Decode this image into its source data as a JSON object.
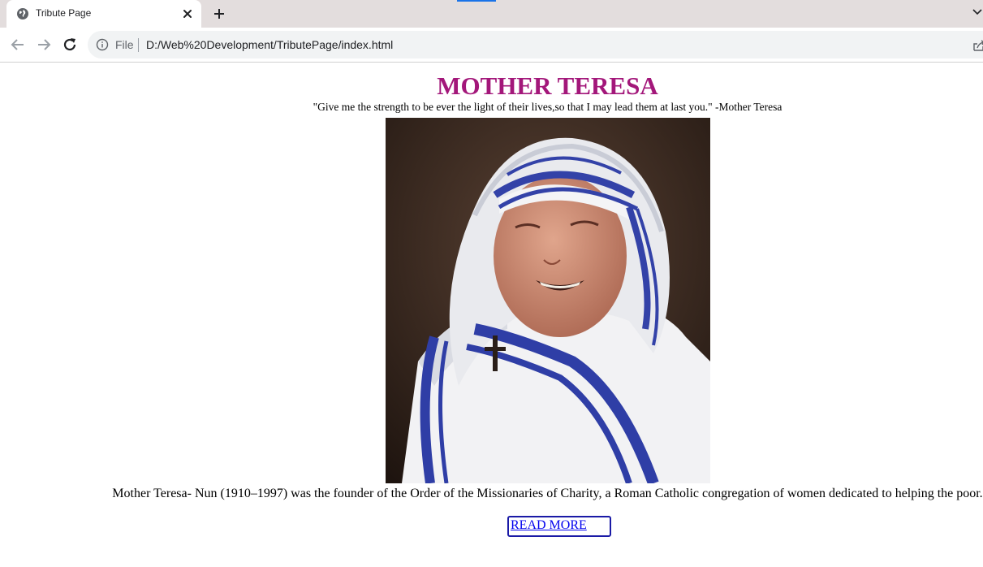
{
  "browser": {
    "tab_title": "Tribute Page",
    "url_scheme": "File",
    "url": "D:/Web%20Development/TributePage/index.html"
  },
  "page": {
    "title": "MOTHER TERESA",
    "quote": "\"Give me the strength to be ever the light of their lives,so that I may lead them at last you.\" -Mother Teresa",
    "bio": "Mother Teresa- Nun (1910–1997) was the founder of the Order of the Missionaries of Charity, a Roman Catholic congregation of women dedicated to helping the poor.",
    "read_more": "READ MORE"
  },
  "colors": {
    "title": "#a3177a",
    "link": "#0000ee",
    "tab_strip": "#e3dddd",
    "omnibox": "#f1f3f4"
  },
  "icons": {
    "tab_favicon": "globe-icon",
    "tab_close": "close-icon",
    "new_tab": "plus-icon",
    "back": "back-arrow-icon",
    "forward": "forward-arrow-icon",
    "reload": "reload-icon",
    "site_info": "info-icon",
    "share": "share-icon",
    "tab_search": "chevron-down-icon"
  }
}
